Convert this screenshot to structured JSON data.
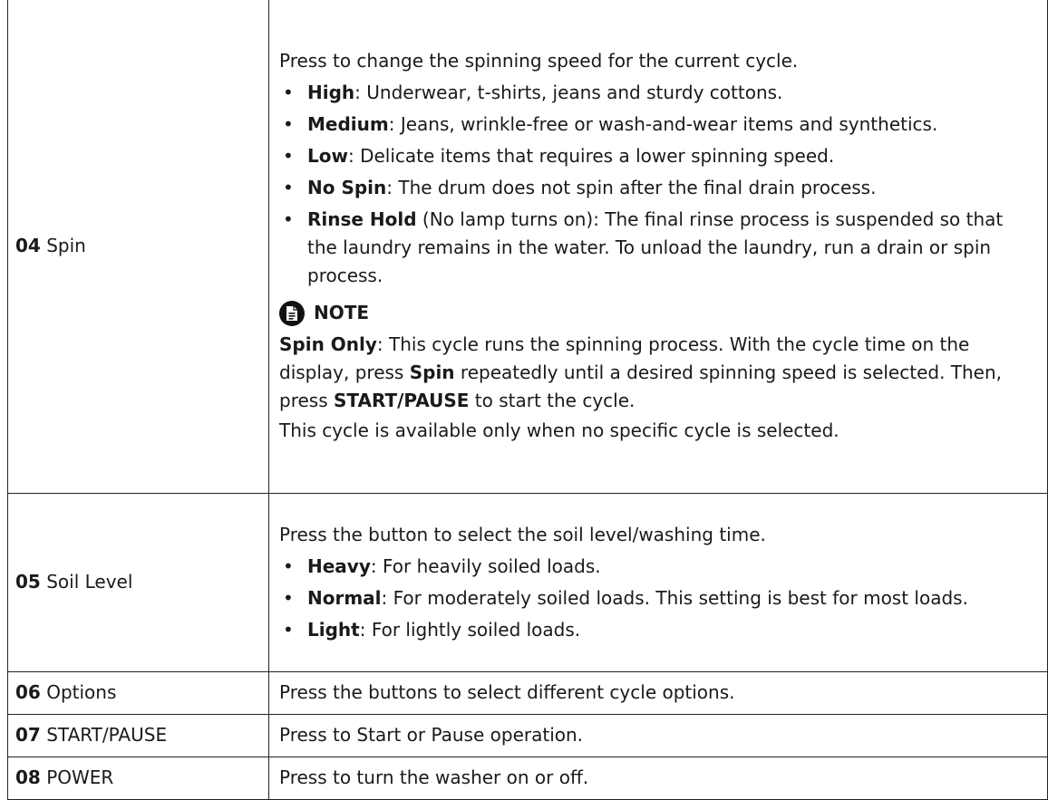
{
  "rows": [
    {
      "num": "04",
      "label": "Spin",
      "intro": "Press to change the spinning speed for the current cycle.",
      "items": [
        {
          "term": "High",
          "text": ": Underwear, t-shirts, jeans and sturdy cottons."
        },
        {
          "term": "Medium",
          "text": ": Jeans, wrinkle-free or wash-and-wear items and synthetics."
        },
        {
          "term": "Low",
          "text": ": Delicate items that requires a lower spinning speed."
        },
        {
          "term": "No Spin",
          "text": ": The drum does not spin after the final drain process."
        },
        {
          "term": "Rinse Hold",
          "text": " (No lamp turns on): The final rinse process is suspended so that the laundry remains in the water. To unload the laundry, run a drain or spin process."
        }
      ],
      "note": {
        "icon": "note-icon",
        "title": "NOTE",
        "p1_term": "Spin Only",
        "p1_text_a": ": This cycle runs the spinning process. With the cycle time on the display, press ",
        "p1_term2": "Spin",
        "p1_text_b": " repeatedly until a desired spinning speed is selected. Then, press ",
        "p1_term3": "START/PAUSE",
        "p1_text_c": " to start the cycle.",
        "p2": "This cycle is available only when no specific cycle is selected."
      }
    },
    {
      "num": "05",
      "label": "Soil Level",
      "intro": "Press the button to select the soil level/washing time.",
      "items": [
        {
          "term": "Heavy",
          "text": ": For heavily soiled loads."
        },
        {
          "term": "Normal",
          "text": ": For moderately soiled loads. This setting is best for most loads."
        },
        {
          "term": "Light",
          "text": ": For lightly soiled loads."
        }
      ]
    },
    {
      "num": "06",
      "label": "Options",
      "intro": "Press the buttons to select different cycle options."
    },
    {
      "num": "07",
      "label": "START/PAUSE",
      "intro": "Press to Start or Pause operation."
    },
    {
      "num": "08",
      "label": "POWER",
      "intro": "Press to turn the washer on or off."
    }
  ]
}
